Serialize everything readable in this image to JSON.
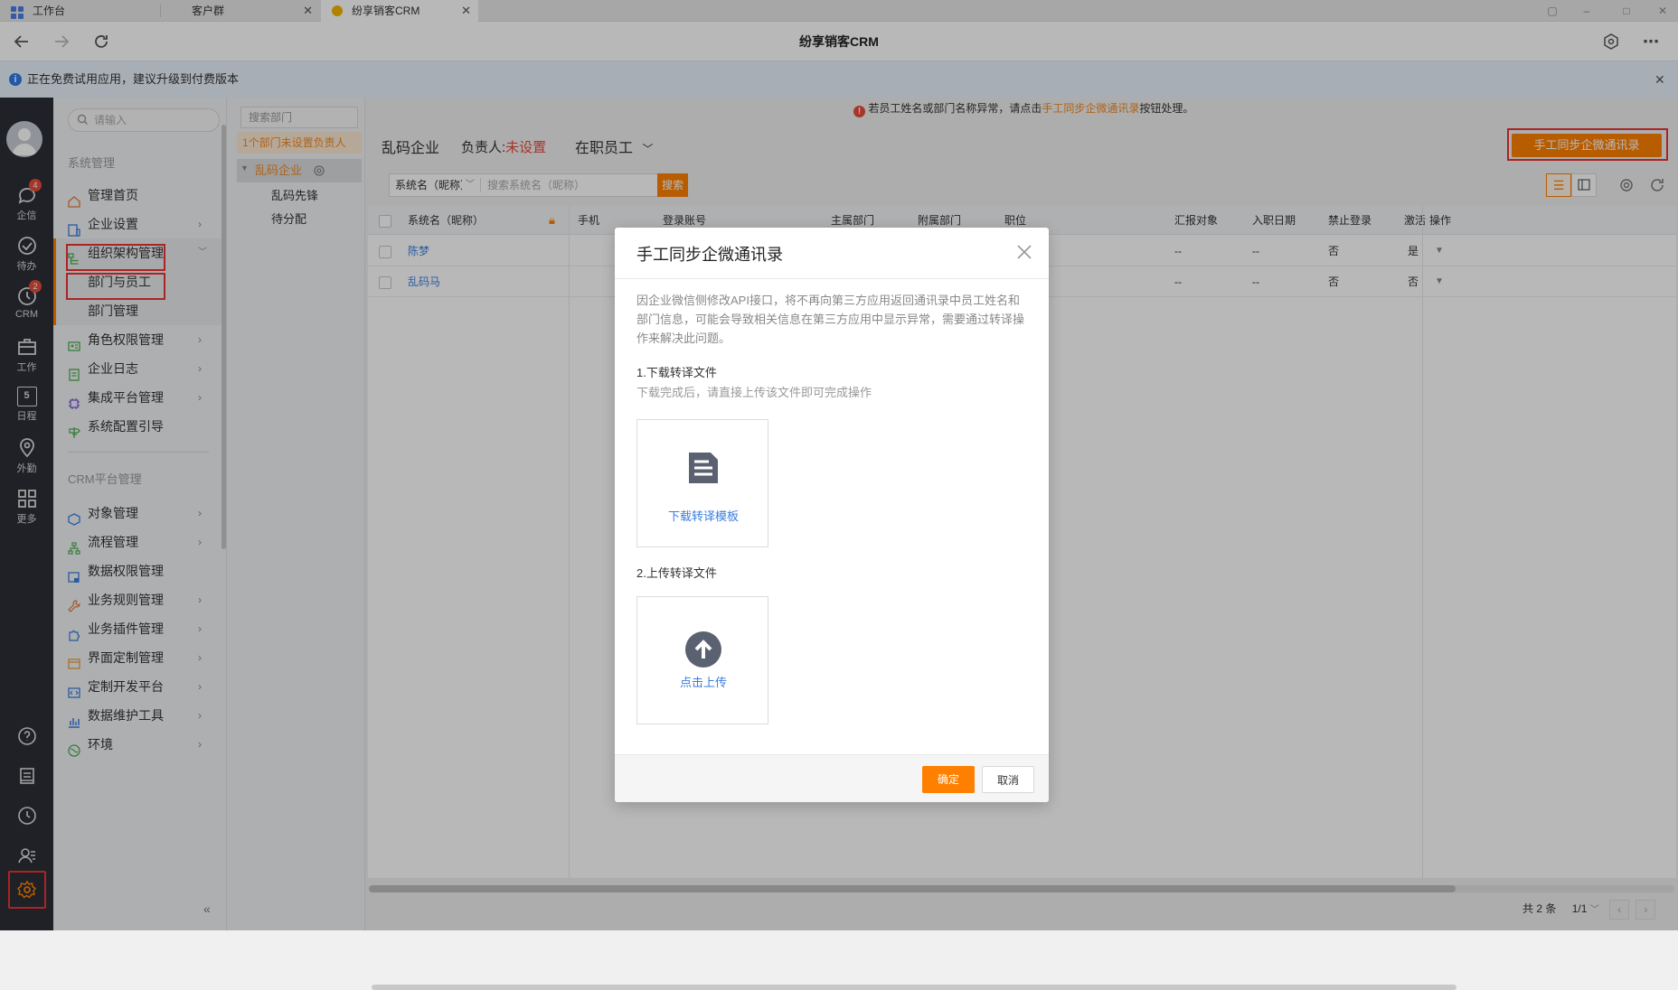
{
  "browser": {
    "tabs": [
      {
        "label": "工作台",
        "closable": false,
        "active": false
      },
      {
        "label": "客户群",
        "closable": true,
        "active": false
      },
      {
        "label": "纷享销客CRM",
        "closable": true,
        "active": true
      }
    ],
    "title": "纷享销客CRM"
  },
  "notice": {
    "text": "正在免费试用应用，建议升级到付费版本"
  },
  "rail": {
    "items": [
      {
        "label": "企信",
        "badge": "4"
      },
      {
        "label": "待办",
        "badge": ""
      },
      {
        "label": "CRM",
        "badge": "2"
      },
      {
        "label": "工作",
        "badge": ""
      },
      {
        "label": "日程",
        "badge": ""
      },
      {
        "label": "外勤",
        "badge": ""
      },
      {
        "label": "更多",
        "badge": ""
      }
    ],
    "calendar_day": "5"
  },
  "sidebar": {
    "search_placeholder": "请输入",
    "group1_title": "系统管理",
    "group1": [
      {
        "label": "管理首页",
        "chevron": false
      },
      {
        "label": "企业设置",
        "chevron": true
      },
      {
        "label": "组织架构管理",
        "chevron": true,
        "expanded": true
      },
      {
        "label": "部门与员工",
        "chevron": false,
        "sub": true,
        "active": true
      },
      {
        "label": "部门管理",
        "chevron": false,
        "sub": true
      },
      {
        "label": "角色权限管理",
        "chevron": true
      },
      {
        "label": "企业日志",
        "chevron": true
      },
      {
        "label": "集成平台管理",
        "chevron": true
      },
      {
        "label": "系统配置引导",
        "chevron": false
      }
    ],
    "group2_title": "CRM平台管理",
    "group2": [
      {
        "label": "对象管理",
        "chevron": true
      },
      {
        "label": "流程管理",
        "chevron": true
      },
      {
        "label": "数据权限管理",
        "chevron": false
      },
      {
        "label": "业务规则管理",
        "chevron": true
      },
      {
        "label": "业务插件管理",
        "chevron": true
      },
      {
        "label": "界面定制管理",
        "chevron": true
      },
      {
        "label": "定制开发平台",
        "chevron": true
      },
      {
        "label": "数据维护工具",
        "chevron": true
      },
      {
        "label": "环境",
        "chevron": true
      }
    ],
    "collapse_label": "«"
  },
  "dept": {
    "search_placeholder": "搜索部门",
    "warning": "1个部门未设置负责人",
    "root": "乱码企业",
    "children": [
      "乱码先锋",
      "待分配"
    ]
  },
  "main": {
    "alert_prefix": "若员工姓名或部门名称异常，请点击",
    "alert_link": "手工同步企微通讯录",
    "alert_suffix": "按钮处理。",
    "company": "乱码企业",
    "owner_label": "负责人:",
    "owner_value": "未设置",
    "status_filter": "在职员工",
    "sync_button": "手工同步企微通讯录",
    "filter_field": "系统名（昵称）",
    "search_placeholder": "搜索系统名（昵称）",
    "search_button": "搜索",
    "columns": [
      "系统名（昵称）",
      "手机",
      "登录账号",
      "主属部门",
      "附属部门",
      "职位",
      "汇报对象",
      "入职日期",
      "禁止登录",
      "激活",
      "操作"
    ],
    "rows": [
      {
        "name": "陈梦",
        "position": "--",
        "report": "--",
        "hire": "--",
        "forbid": "否",
        "active": "是"
      },
      {
        "name": "乱码马",
        "position": "--",
        "report": "--",
        "hire": "--",
        "forbid": "否",
        "active": "否"
      }
    ],
    "total": "共 2 条",
    "pager": "1/1"
  },
  "modal": {
    "title": "手工同步企微通讯录",
    "description": "因企业微信侧修改API接口，将不再向第三方应用返回通讯录中员工姓名和部门信息，可能会导致相关信息在第三方应用中显示异常，需要通过转译操作来解决此问题。",
    "step1_title": "1.下载转译文件",
    "step1_hint": "下载完成后，请直接上传该文件即可完成操作",
    "download_label": "下载转译模板",
    "step2_title": "2.上传转译文件",
    "upload_label": "点击上传",
    "confirm": "确定",
    "cancel": "取消"
  },
  "colors": {
    "accent": "#ff8000",
    "link": "#3a7de0",
    "danger": "#e64a3b",
    "highlight_box": "#e33"
  }
}
